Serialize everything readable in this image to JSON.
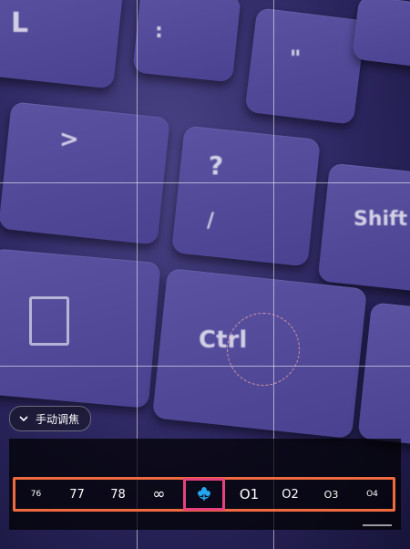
{
  "controls": {
    "manual_adjust_label": "手动调焦"
  },
  "focus_stops": [
    {
      "label": "76",
      "kind": "distance",
      "selected": false
    },
    {
      "label": "77",
      "kind": "distance",
      "selected": false
    },
    {
      "label": "78",
      "kind": "distance",
      "selected": false
    },
    {
      "label": "∞",
      "kind": "distance",
      "selected": false
    },
    {
      "label": "",
      "kind": "macro-icon",
      "selected": true
    },
    {
      "label": "O1",
      "kind": "distance",
      "selected": false
    },
    {
      "label": "O2",
      "kind": "distance",
      "selected": false
    },
    {
      "label": "O3",
      "kind": "distance",
      "selected": false
    },
    {
      "label": "O4",
      "kind": "distance",
      "selected": false
    }
  ],
  "viewfinder": {
    "key_legends": [
      "L",
      ":",
      "\"",
      ">",
      "?",
      "/",
      "Shift",
      "Ctrl"
    ]
  },
  "colors": {
    "strip_border": "#f06a3f",
    "selected_border": "#e8427c",
    "macro_icon": "#22a7f0"
  }
}
